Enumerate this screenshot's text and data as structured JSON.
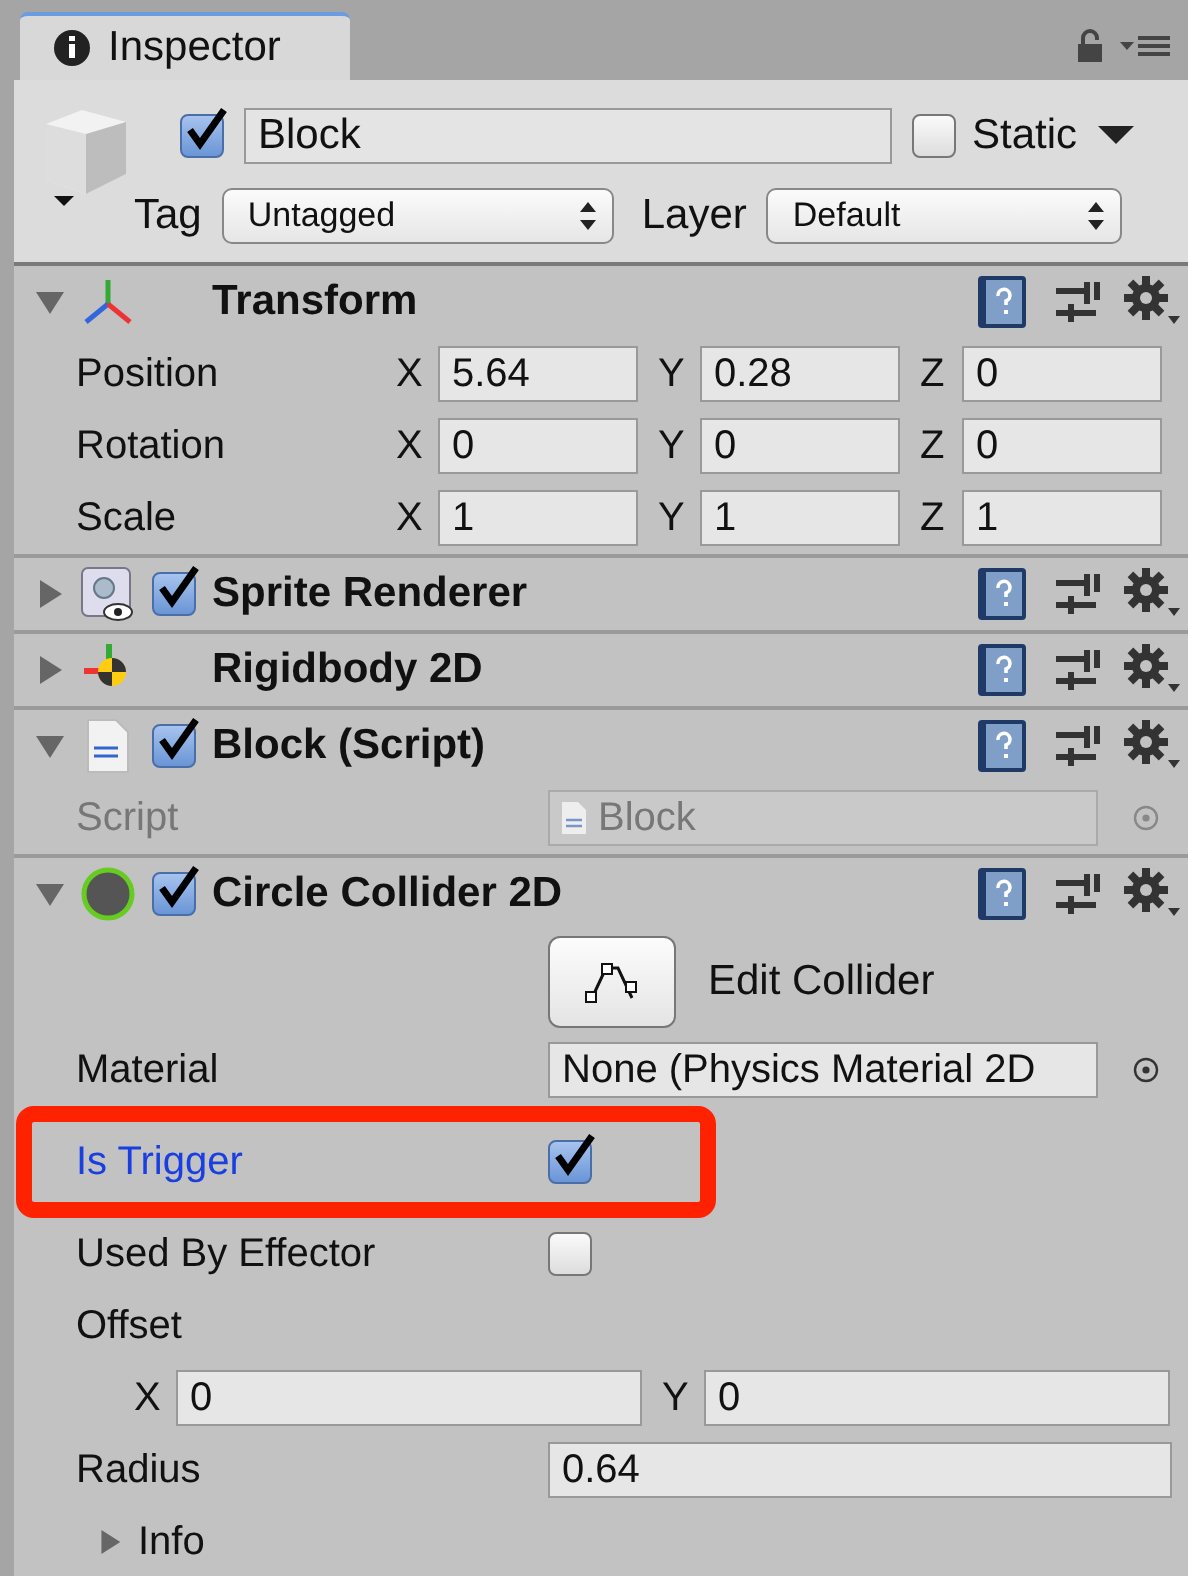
{
  "tab": {
    "title": "Inspector"
  },
  "game_object": {
    "active": true,
    "name": "Block",
    "static": false,
    "static_label": "Static",
    "tag_label": "Tag",
    "tag": "Untagged",
    "layer_label": "Layer",
    "layer": "Default"
  },
  "components": [
    {
      "kind": "transform",
      "title": "Transform",
      "expanded": true,
      "rows": [
        {
          "label": "Position",
          "fields": [
            {
              "axis": "X",
              "value": "5.64"
            },
            {
              "axis": "Y",
              "value": "0.28"
            },
            {
              "axis": "Z",
              "value": "0"
            }
          ]
        },
        {
          "label": "Rotation",
          "fields": [
            {
              "axis": "X",
              "value": "0"
            },
            {
              "axis": "Y",
              "value": "0"
            },
            {
              "axis": "Z",
              "value": "0"
            }
          ]
        },
        {
          "label": "Scale",
          "fields": [
            {
              "axis": "X",
              "value": "1"
            },
            {
              "axis": "Y",
              "value": "1"
            },
            {
              "axis": "Z",
              "value": "1"
            }
          ]
        }
      ]
    },
    {
      "kind": "sprite_renderer",
      "title": "Sprite Renderer",
      "expanded": false,
      "enabled": true
    },
    {
      "kind": "rigidbody",
      "title": "Rigidbody 2D",
      "expanded": false
    },
    {
      "kind": "script",
      "title": "Block (Script)",
      "expanded": true,
      "enabled": true,
      "properties": [
        {
          "kind": "object",
          "label": "Script",
          "value": "Block",
          "disabled": true
        }
      ]
    },
    {
      "kind": "circle_collider",
      "title": "Circle Collider 2D",
      "expanded": true,
      "enabled": true,
      "properties": [
        {
          "kind": "button",
          "label": "Edit Collider"
        },
        {
          "kind": "object",
          "label": "Material",
          "value": "None (Physics Material 2D",
          "disabled": false
        },
        {
          "kind": "checkbox",
          "label": "Is Trigger",
          "checked": true,
          "focused": true,
          "highlighted": true
        },
        {
          "kind": "checkbox",
          "label": "Used By Effector",
          "checked": false,
          "focused": false,
          "highlighted": false
        },
        {
          "kind": "heading",
          "label": "Offset"
        },
        {
          "kind": "vector",
          "fields": [
            {
              "axis": "X",
              "value": "0"
            },
            {
              "axis": "Y",
              "value": "0"
            }
          ]
        },
        {
          "kind": "number",
          "label": "Radius",
          "value": "0.64"
        },
        {
          "kind": "foldout",
          "label": "Info",
          "expanded": false
        }
      ]
    }
  ]
}
